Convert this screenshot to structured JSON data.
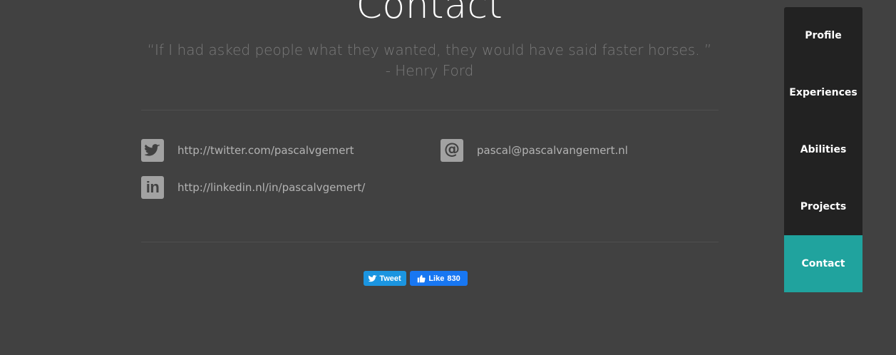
{
  "heading": "Contact",
  "quote": {
    "text": "“If I had asked people what they wanted, they would have said faster horses. ”",
    "author": "- Henry Ford"
  },
  "contacts": {
    "twitter": {
      "icon": "twitter-icon",
      "text": "http://twitter.com/pascalvgemert"
    },
    "linkedin": {
      "icon": "linkedin-icon",
      "text": "http://linkedin.nl/in/pascalvgemert/"
    },
    "email": {
      "icon": "at-sign-icon",
      "text": "pascal@pascalvangemert.nl"
    }
  },
  "share": {
    "tweet_label": "Tweet",
    "like_label": "Like",
    "like_count": "830"
  },
  "nav": {
    "items": [
      {
        "label": "Profile"
      },
      {
        "label": "Experiences"
      },
      {
        "label": "Abilities"
      },
      {
        "label": "Projects"
      },
      {
        "label": "Contact",
        "active": true
      }
    ]
  },
  "colors": {
    "background": "#414141",
    "nav_background": "#222222",
    "active_accent": "#20a39e",
    "icon_tile": "#a2a2a2",
    "tweet_blue": "#1b95e0",
    "like_blue": "#1877f2"
  }
}
